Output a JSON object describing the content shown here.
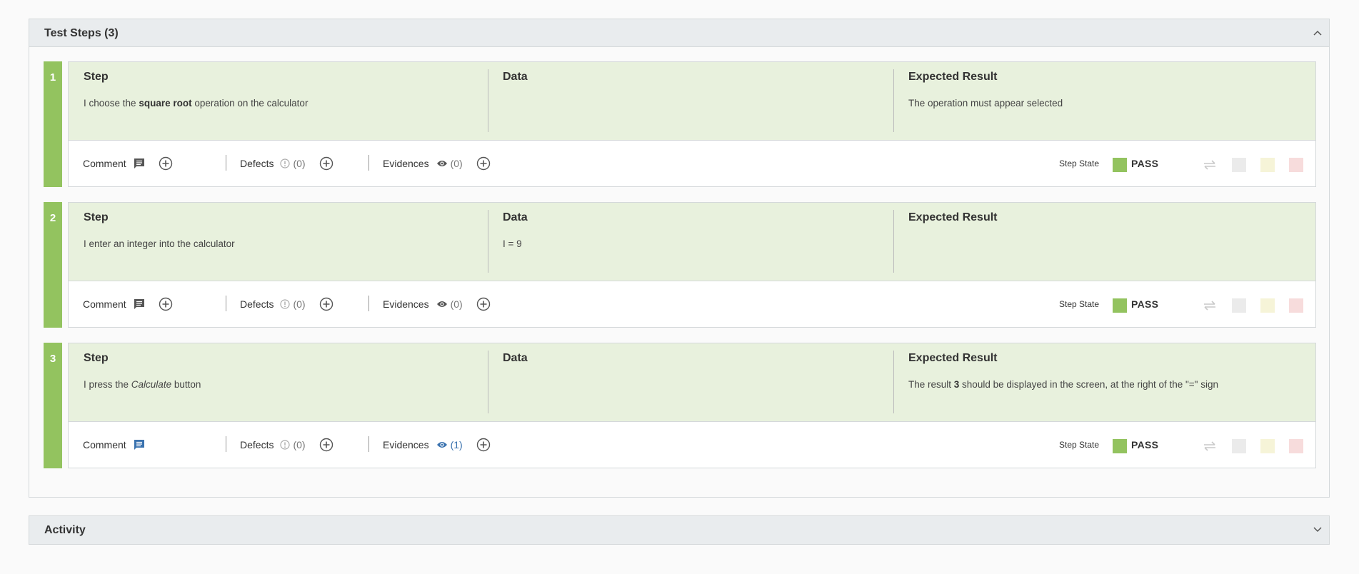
{
  "test_steps": {
    "title": "Test Steps (3)",
    "columns": {
      "step": "Step",
      "data": "Data",
      "expected": "Expected Result"
    },
    "footer": {
      "comment_label": "Comment",
      "defects_label": "Defects",
      "evidences_label": "Evidences",
      "step_state_label": "Step State"
    },
    "steps": [
      {
        "number": "1",
        "step_before": "I choose the ",
        "step_emph": "square root",
        "step_after": " operation on the calculator",
        "data": "",
        "expected_before": "The operation must appear selected",
        "expected_emph": "",
        "expected_after": "",
        "defects_count": "(0)",
        "evidences_count": "(0)",
        "state": "PASS"
      },
      {
        "number": "2",
        "step_before": "I enter an integer into the calculator",
        "step_emph": "",
        "step_after": "",
        "data": "I = 9",
        "expected_before": "",
        "expected_emph": "",
        "expected_after": "",
        "defects_count": "(0)",
        "evidences_count": "(0)",
        "state": "PASS"
      },
      {
        "number": "3",
        "step_before": "I press the ",
        "step_emph": "Calculate",
        "step_after": " button",
        "data": "",
        "expected_before": "The result ",
        "expected_emph": "3",
        "expected_after": " should be displayed in the screen, at the right of the \"=\" sign",
        "defects_count": "(0)",
        "evidences_count": "(1)",
        "state": "PASS"
      }
    ]
  },
  "activity": {
    "title": "Activity"
  },
  "colors": {
    "pass": "#93c35f",
    "active_link": "#3b73af",
    "step_bg": "#e8f1dd"
  },
  "icons": {
    "collapse": "chevron-up-icon",
    "expand": "chevron-down-icon",
    "comment": "comment-icon",
    "defect": "exclamation-circle-icon",
    "evidence": "eye-icon",
    "add": "plus-circle-icon",
    "reset": "swap-arrows-icon"
  }
}
